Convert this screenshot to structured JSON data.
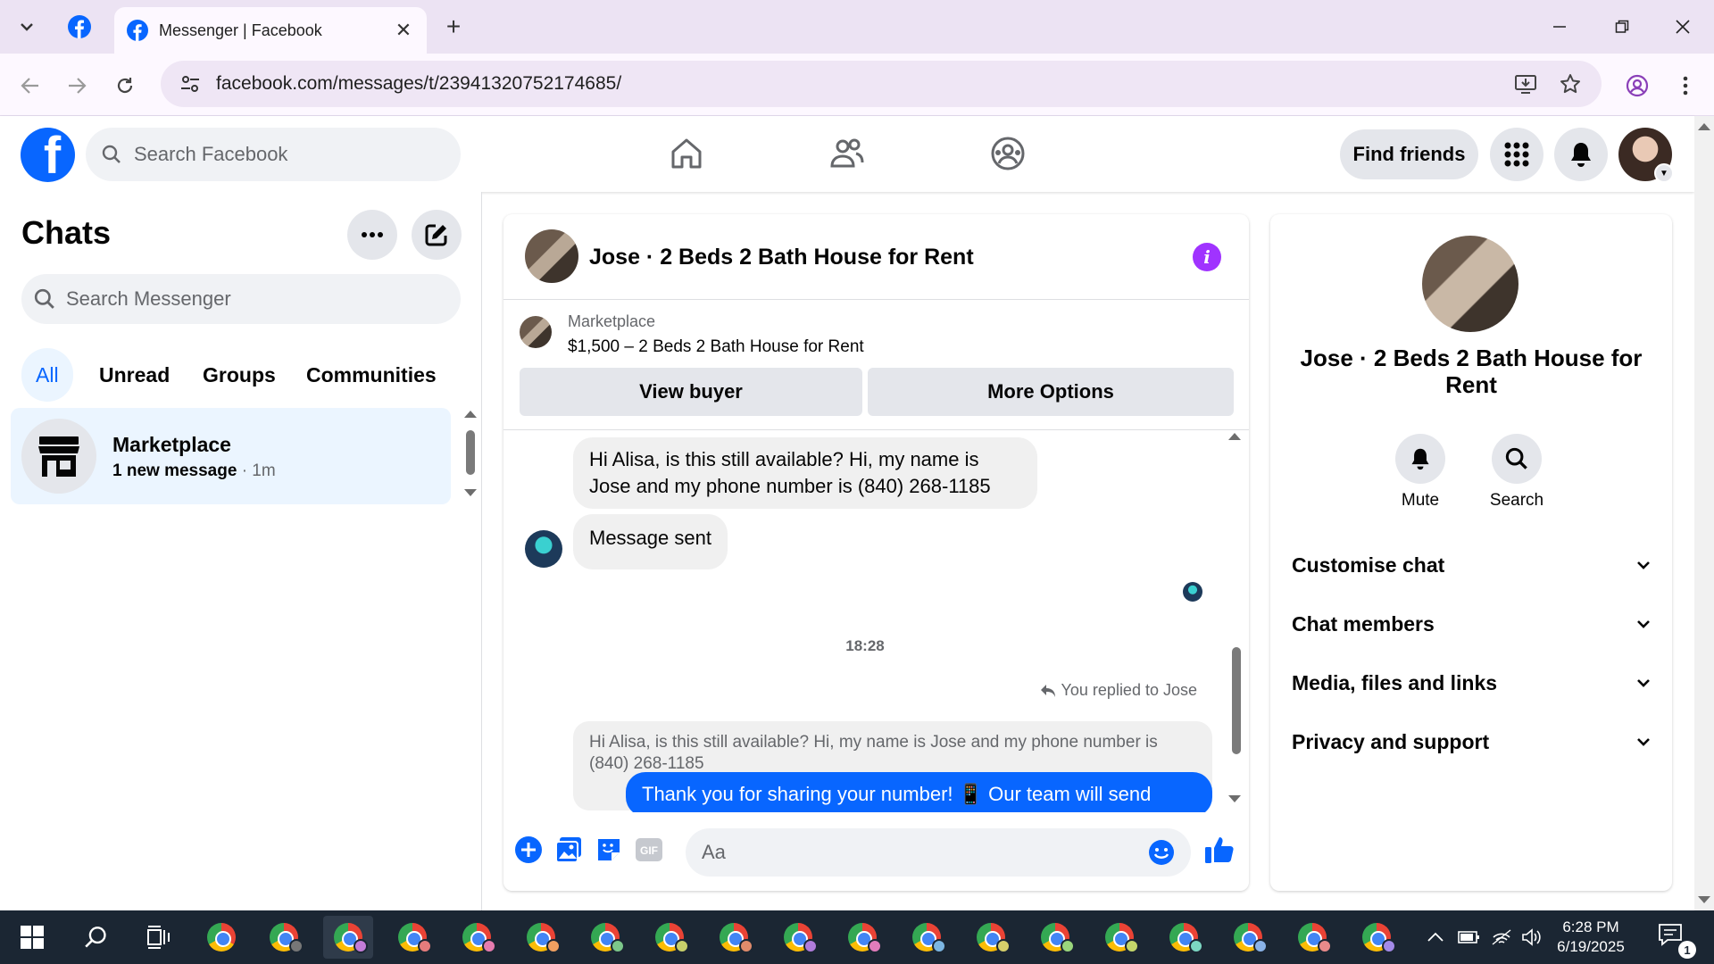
{
  "browser": {
    "tab_title": "Messenger | Facebook",
    "url": "facebook.com/messages/t/23941320752174685/"
  },
  "fb": {
    "search_placeholder": "Search Facebook",
    "find_friends": "Find friends"
  },
  "chats": {
    "title": "Chats",
    "search_placeholder": "Search Messenger",
    "filters": [
      "All",
      "Unread",
      "Groups",
      "Communities"
    ],
    "items": [
      {
        "name": "Marketplace",
        "subtitle": "1 new message",
        "time": "· 1m"
      }
    ]
  },
  "conversation": {
    "title": "Jose · 2 Beds 2 Bath House for Rent",
    "marketplace_label": "Marketplace",
    "listing": "$1,500 – 2 Beds 2 Bath House for Rent",
    "view_buyer": "View buyer",
    "more_options": "More Options",
    "messages": {
      "incoming_1": "Hi Alisa, is this still available? Hi, my name is Jose and my phone number is (840) 268-1185",
      "incoming_2": "Message sent",
      "timestamp": "18:28",
      "replied_to": "You replied to Jose",
      "quoted": "Hi Alisa, is this still available? Hi, my name is Jose and my phone number is (840) 268-1185",
      "outgoing": "Thank you for sharing your number! 📱 Our team will send"
    },
    "composer_placeholder": "Aa"
  },
  "info_panel": {
    "name": "Jose · 2 Beds 2 Bath House for Rent",
    "actions": [
      "Mute",
      "Search"
    ],
    "sections": [
      "Customise chat",
      "Chat members",
      "Media, files and links",
      "Privacy and support"
    ]
  },
  "taskbar": {
    "time": "6:28 PM",
    "date": "6/19/2025",
    "notifications": "1"
  },
  "colors": {
    "fb_blue": "#0866ff",
    "info_purple": "#a033ff",
    "chrome_frame": "#ece3f3"
  }
}
